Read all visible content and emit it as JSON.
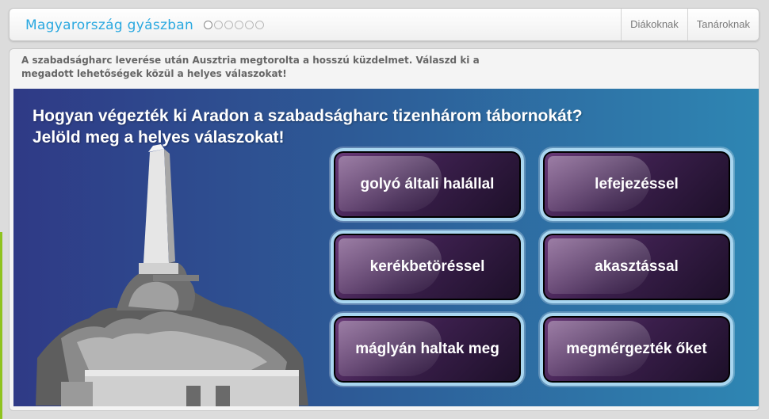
{
  "header": {
    "title": "Magyarország gyászban",
    "progress": {
      "total": 6,
      "current": 1
    },
    "nav": [
      "Diákoknak",
      "Tanároknak"
    ]
  },
  "instruction": "A szabadságharc leverése után Ausztria megtorolta a hosszú küzdelmet. Válaszd ki a megadott lehetőségek közül a helyes válaszokat!",
  "question": {
    "line1": "Hogyan végezték ki Aradon a szabadságharc tizenhárom tábornokát?",
    "line2": "Jelöld meg a helyes válaszokat!"
  },
  "answers": [
    "golyó általi halállal",
    "lefejezéssel",
    "kerékbetöréssel",
    "akasztással",
    "máglyán haltak meg",
    "megmérgezték őket"
  ],
  "colors": {
    "accent": "#29a8e0",
    "stage_left": "#2f3a86",
    "stage_right": "#2e86b3",
    "answer_border": "#a9d6f0"
  }
}
